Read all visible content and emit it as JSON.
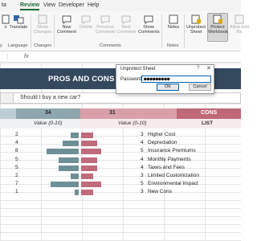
{
  "ribbon": {
    "tabs": [
      "ta",
      "Review",
      "View",
      "Developer",
      "Help"
    ],
    "active_tab": "Review",
    "buttons": [
      {
        "label": "n",
        "enabled": true
      },
      {
        "label": "Translate",
        "enabled": true
      },
      {
        "label": "Show Changes",
        "enabled": false
      },
      {
        "label": "New Comment",
        "enabled": true
      },
      {
        "label": "Delete",
        "enabled": false
      },
      {
        "label": "Previous Comment",
        "enabled": false
      },
      {
        "label": "Next Comment",
        "enabled": false
      },
      {
        "label": "Show Comments",
        "enabled": true
      },
      {
        "label": "Notes",
        "enabled": true
      },
      {
        "label": "Unprotect Sheet",
        "enabled": true
      },
      {
        "label": "Protect Workbook",
        "enabled": true
      },
      {
        "label": "Allow Edit Ra",
        "enabled": false
      }
    ],
    "groups": [
      "y",
      "Language",
      "Changes",
      "Comments",
      "Notes"
    ],
    "accent": "#1e6b3a"
  },
  "formula_bar": {
    "fx": "fx"
  },
  "sheet": {
    "title": "PROS AND CONS LIST",
    "question": "Should I buy a new car?",
    "pros_total": "34",
    "cons_total": "31",
    "cons_header": "CONS",
    "value_header": "Value (0-10)",
    "value_header_cons": "Value (0-10)",
    "list_header": "LIST",
    "colors": {
      "title_band": "#34495e",
      "pros_bar": "#6f8f96",
      "cons_bar": "#c06b7c",
      "cons_header": "#bf6878"
    }
  },
  "chart_data": {
    "type": "bar",
    "pros_values": [
      2,
      4,
      8,
      5,
      5,
      2,
      7,
      1
    ],
    "cons_values": [
      3,
      4,
      5,
      4,
      4,
      3,
      5,
      3
    ],
    "cons_list": [
      "Higher Cost",
      "Depreciation",
      "Insurance Premiums",
      "Monthly Payments",
      "Taxes and Fees",
      "Limited Customization",
      "Environmental Impact",
      "New Cons"
    ]
  },
  "dialog": {
    "title": "Unprotect Sheet",
    "help": "?",
    "close": "✕",
    "password_label": "Password:",
    "password_value": "●●●●●●●●●",
    "ok_label": "OK",
    "cancel_label": "Cancel"
  }
}
